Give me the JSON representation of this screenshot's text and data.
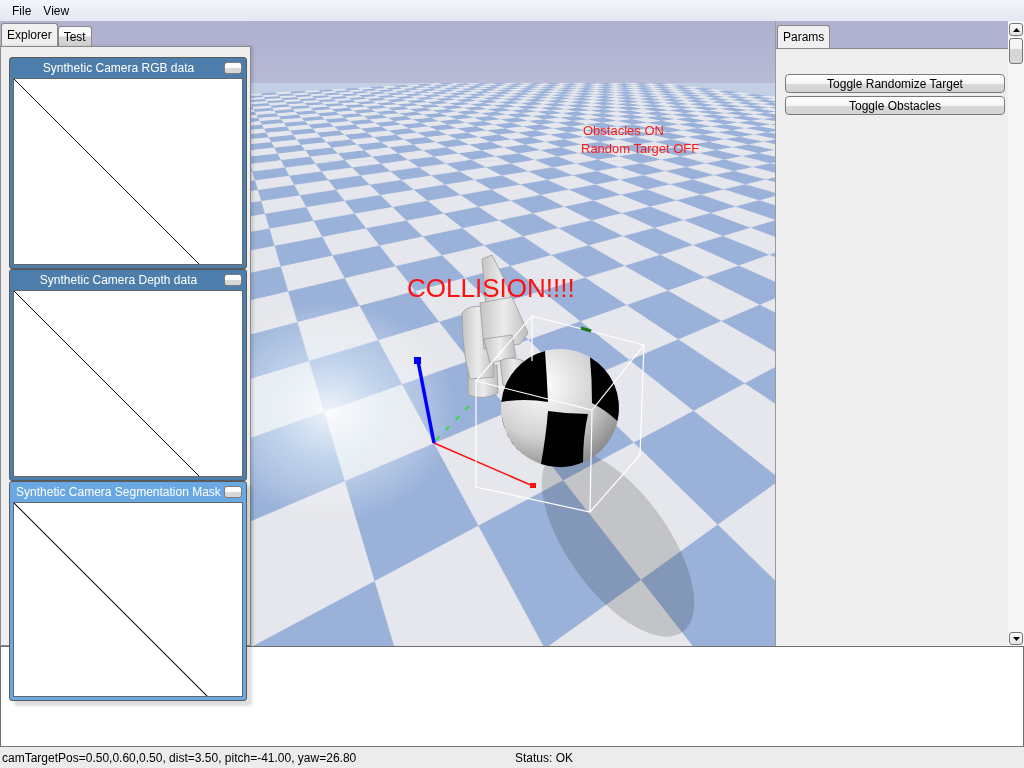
{
  "menu_bar": [
    "File",
    "View"
  ],
  "left_dock": {
    "tabs": [
      {
        "label": "Explorer",
        "selected": true
      },
      {
        "label": "Test",
        "selected": false
      }
    ],
    "panels": [
      {
        "title": "Synthetic Camera RGB data",
        "active": false
      },
      {
        "title": "Synthetic Camera Depth data",
        "active": false
      },
      {
        "title": "Synthetic Camera Segmentation Mask",
        "active": true
      }
    ]
  },
  "viewport": {
    "info_lines": [
      "Obstacles ON",
      "Random Target OFF"
    ],
    "alert": "COLLISION!!!!"
  },
  "right_dock": {
    "tabs": [
      {
        "label": "Params",
        "selected": true
      }
    ],
    "buttons": [
      "Toggle Randomize Target",
      "Toggle Obstacles"
    ]
  },
  "status_bar": {
    "camera": "camTargetPos=0.50,0.60,0.50, dist=3.50, pitch=-41.00, yaw=26.80",
    "status": "Status: OK"
  }
}
